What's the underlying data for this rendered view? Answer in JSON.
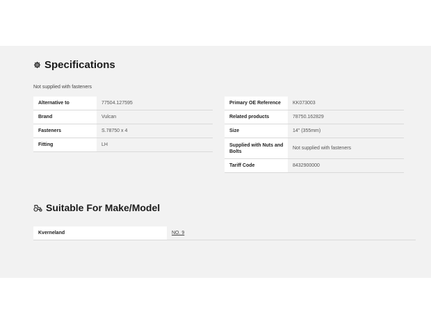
{
  "specifications": {
    "heading": "Specifications",
    "icon": "gear-icon",
    "note": "Not supplied with fasteners",
    "left_rows": [
      {
        "label": "Alternative to",
        "value": "77504.127595"
      },
      {
        "label": "Brand",
        "value": "Vulcan"
      },
      {
        "label": "Fasteners",
        "value": "S.78750 x 4"
      },
      {
        "label": "Fitting",
        "value": "LH"
      }
    ],
    "right_rows": [
      {
        "label": "Primary OE Reference",
        "value": "KK073003"
      },
      {
        "label": "Related products",
        "value": "78750.162829"
      },
      {
        "label": "Size",
        "value": "14\" (355mm)"
      },
      {
        "label": "Supplied with Nuts and Bolts",
        "value": "Not supplied with fasteners"
      },
      {
        "label": "Tariff Code",
        "value": "8432900000"
      }
    ]
  },
  "suitable": {
    "heading": "Suitable For Make/Model",
    "icon": "tractor-icon",
    "rows": [
      {
        "make": "Kverneland",
        "model": "NO. 9"
      }
    ]
  },
  "colors": {
    "panel_bg": "#f2f2f2",
    "divider": "#d9d9d9"
  }
}
